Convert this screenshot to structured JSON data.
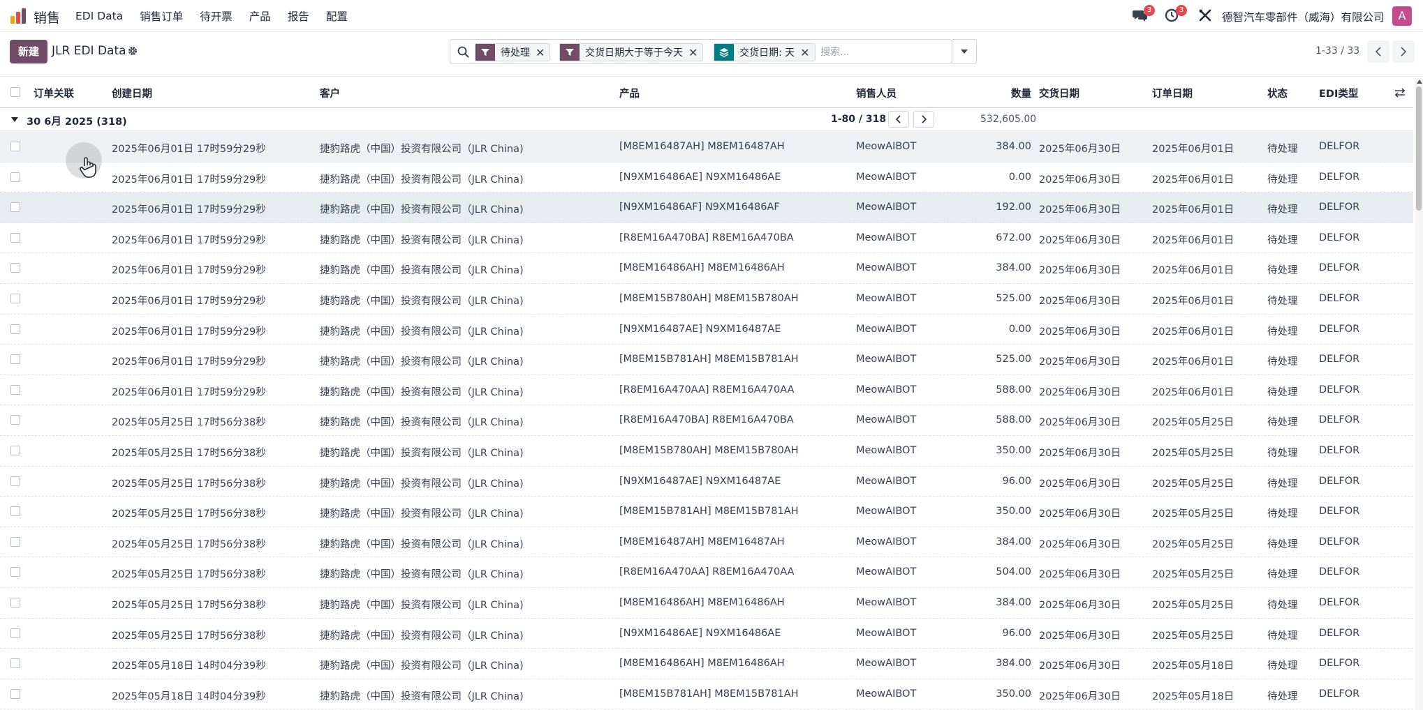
{
  "navbar": {
    "app_name": "销售",
    "menu": [
      "EDI Data",
      "销售订单",
      "待开票",
      "产品",
      "报告",
      "配置"
    ],
    "messages_badge": "3",
    "activities_badge": "3",
    "company": "德智汽车零部件（威海）有限公司",
    "avatar_letter": "A",
    "avatar_color": "#c44d8b"
  },
  "control": {
    "new_label": "新建",
    "title": "JLR EDI Data",
    "search": {
      "facets": [
        {
          "type": "filter",
          "label": "待处理"
        },
        {
          "type": "filter",
          "label": "交货日期大于等于今天"
        },
        {
          "type": "group",
          "label": "交货日期: 天"
        }
      ],
      "placeholder": "搜索..."
    },
    "pager": "1-33 / 33"
  },
  "table": {
    "columns": [
      "订单关联",
      "创建日期",
      "客户",
      "产品",
      "销售人员",
      "数量",
      "交货日期",
      "订单日期",
      "状态",
      "EDI类型"
    ],
    "group": {
      "label": "30 6月 2025 (318)",
      "pager": "1-80 / 318",
      "quantity_sum": "532,605.00"
    },
    "rows": [
      {
        "created": "2025年06月01日 17时59分29秒",
        "customer": "捷豹路虎（中国）投资有限公司（JLR China)",
        "product": "[M8EM16487AH] M8EM16487AH",
        "salesperson": "MeowAIBOT",
        "qty": "384.00",
        "delivery": "2025年06月30日",
        "order_date": "2025年06月01日",
        "status": "待处理",
        "edi": "DELFOR"
      },
      {
        "created": "2025年06月01日 17时59分29秒",
        "customer": "捷豹路虎（中国）投资有限公司（JLR China)",
        "product": "[N9XM16486AE] N9XM16486AE",
        "salesperson": "MeowAIBOT",
        "qty": "0.00",
        "delivery": "2025年06月30日",
        "order_date": "2025年06月01日",
        "status": "待处理",
        "edi": "DELFOR"
      },
      {
        "created": "2025年06月01日 17时59分29秒",
        "customer": "捷豹路虎（中国）投资有限公司（JLR China)",
        "product": "[N9XM16486AF] N9XM16486AF",
        "salesperson": "MeowAIBOT",
        "qty": "192.00",
        "delivery": "2025年06月30日",
        "order_date": "2025年06月01日",
        "status": "待处理",
        "edi": "DELFOR"
      },
      {
        "created": "2025年06月01日 17时59分29秒",
        "customer": "捷豹路虎（中国）投资有限公司（JLR China)",
        "product": "[R8EM16A470BA] R8EM16A470BA",
        "salesperson": "MeowAIBOT",
        "qty": "672.00",
        "delivery": "2025年06月30日",
        "order_date": "2025年06月01日",
        "status": "待处理",
        "edi": "DELFOR"
      },
      {
        "created": "2025年06月01日 17时59分29秒",
        "customer": "捷豹路虎（中国）投资有限公司（JLR China)",
        "product": "[M8EM16486AH] M8EM16486AH",
        "salesperson": "MeowAIBOT",
        "qty": "384.00",
        "delivery": "2025年06月30日",
        "order_date": "2025年06月01日",
        "status": "待处理",
        "edi": "DELFOR"
      },
      {
        "created": "2025年06月01日 17时59分29秒",
        "customer": "捷豹路虎（中国）投资有限公司（JLR China)",
        "product": "[M8EM15B780AH] M8EM15B780AH",
        "salesperson": "MeowAIBOT",
        "qty": "525.00",
        "delivery": "2025年06月30日",
        "order_date": "2025年06月01日",
        "status": "待处理",
        "edi": "DELFOR"
      },
      {
        "created": "2025年06月01日 17时59分29秒",
        "customer": "捷豹路虎（中国）投资有限公司（JLR China)",
        "product": "[N9XM16487AE] N9XM16487AE",
        "salesperson": "MeowAIBOT",
        "qty": "0.00",
        "delivery": "2025年06月30日",
        "order_date": "2025年06月01日",
        "status": "待处理",
        "edi": "DELFOR"
      },
      {
        "created": "2025年06月01日 17时59分29秒",
        "customer": "捷豹路虎（中国）投资有限公司（JLR China)",
        "product": "[M8EM15B781AH] M8EM15B781AH",
        "salesperson": "MeowAIBOT",
        "qty": "525.00",
        "delivery": "2025年06月30日",
        "order_date": "2025年06月01日",
        "status": "待处理",
        "edi": "DELFOR"
      },
      {
        "created": "2025年06月01日 17时59分29秒",
        "customer": "捷豹路虎（中国）投资有限公司（JLR China)",
        "product": "[R8EM16A470AA] R8EM16A470AA",
        "salesperson": "MeowAIBOT",
        "qty": "588.00",
        "delivery": "2025年06月30日",
        "order_date": "2025年06月01日",
        "status": "待处理",
        "edi": "DELFOR"
      },
      {
        "created": "2025年05月25日 17时56分38秒",
        "customer": "捷豹路虎（中国）投资有限公司（JLR China)",
        "product": "[R8EM16A470BA] R8EM16A470BA",
        "salesperson": "MeowAIBOT",
        "qty": "588.00",
        "delivery": "2025年06月30日",
        "order_date": "2025年05月25日",
        "status": "待处理",
        "edi": "DELFOR"
      },
      {
        "created": "2025年05月25日 17时56分38秒",
        "customer": "捷豹路虎（中国）投资有限公司（JLR China)",
        "product": "[M8EM15B780AH] M8EM15B780AH",
        "salesperson": "MeowAIBOT",
        "qty": "350.00",
        "delivery": "2025年06月30日",
        "order_date": "2025年05月25日",
        "status": "待处理",
        "edi": "DELFOR"
      },
      {
        "created": "2025年05月25日 17时56分38秒",
        "customer": "捷豹路虎（中国）投资有限公司（JLR China)",
        "product": "[N9XM16487AE] N9XM16487AE",
        "salesperson": "MeowAIBOT",
        "qty": "96.00",
        "delivery": "2025年06月30日",
        "order_date": "2025年05月25日",
        "status": "待处理",
        "edi": "DELFOR"
      },
      {
        "created": "2025年05月25日 17时56分38秒",
        "customer": "捷豹路虎（中国）投资有限公司（JLR China)",
        "product": "[M8EM15B781AH] M8EM15B781AH",
        "salesperson": "MeowAIBOT",
        "qty": "350.00",
        "delivery": "2025年06月30日",
        "order_date": "2025年05月25日",
        "status": "待处理",
        "edi": "DELFOR"
      },
      {
        "created": "2025年05月25日 17时56分38秒",
        "customer": "捷豹路虎（中国）投资有限公司（JLR China)",
        "product": "[M8EM16487AH] M8EM16487AH",
        "salesperson": "MeowAIBOT",
        "qty": "384.00",
        "delivery": "2025年06月30日",
        "order_date": "2025年05月25日",
        "status": "待处理",
        "edi": "DELFOR"
      },
      {
        "created": "2025年05月25日 17时56分38秒",
        "customer": "捷豹路虎（中国）投资有限公司（JLR China)",
        "product": "[R8EM16A470AA] R8EM16A470AA",
        "salesperson": "MeowAIBOT",
        "qty": "504.00",
        "delivery": "2025年06月30日",
        "order_date": "2025年05月25日",
        "status": "待处理",
        "edi": "DELFOR"
      },
      {
        "created": "2025年05月25日 17时56分38秒",
        "customer": "捷豹路虎（中国）投资有限公司（JLR China)",
        "product": "[M8EM16486AH] M8EM16486AH",
        "salesperson": "MeowAIBOT",
        "qty": "384.00",
        "delivery": "2025年06月30日",
        "order_date": "2025年05月25日",
        "status": "待处理",
        "edi": "DELFOR"
      },
      {
        "created": "2025年05月25日 17时56分38秒",
        "customer": "捷豹路虎（中国）投资有限公司（JLR China)",
        "product": "[N9XM16486AE] N9XM16486AE",
        "salesperson": "MeowAIBOT",
        "qty": "96.00",
        "delivery": "2025年06月30日",
        "order_date": "2025年05月25日",
        "status": "待处理",
        "edi": "DELFOR"
      },
      {
        "created": "2025年05月18日 14时04分39秒",
        "customer": "捷豹路虎（中国）投资有限公司（JLR China)",
        "product": "[M8EM16486AH] M8EM16486AH",
        "salesperson": "MeowAIBOT",
        "qty": "384.00",
        "delivery": "2025年06月30日",
        "order_date": "2025年05月18日",
        "status": "待处理",
        "edi": "DELFOR"
      },
      {
        "created": "2025年05月18日 14时04分39秒",
        "customer": "捷豹路虎（中国）投资有限公司（JLR China)",
        "product": "[M8EM15B781AH] M8EM15B781AH",
        "salesperson": "MeowAIBOT",
        "qty": "350.00",
        "delivery": "2025年06月30日",
        "order_date": "2025年05月18日",
        "status": "待处理",
        "edi": "DELFOR"
      }
    ]
  }
}
